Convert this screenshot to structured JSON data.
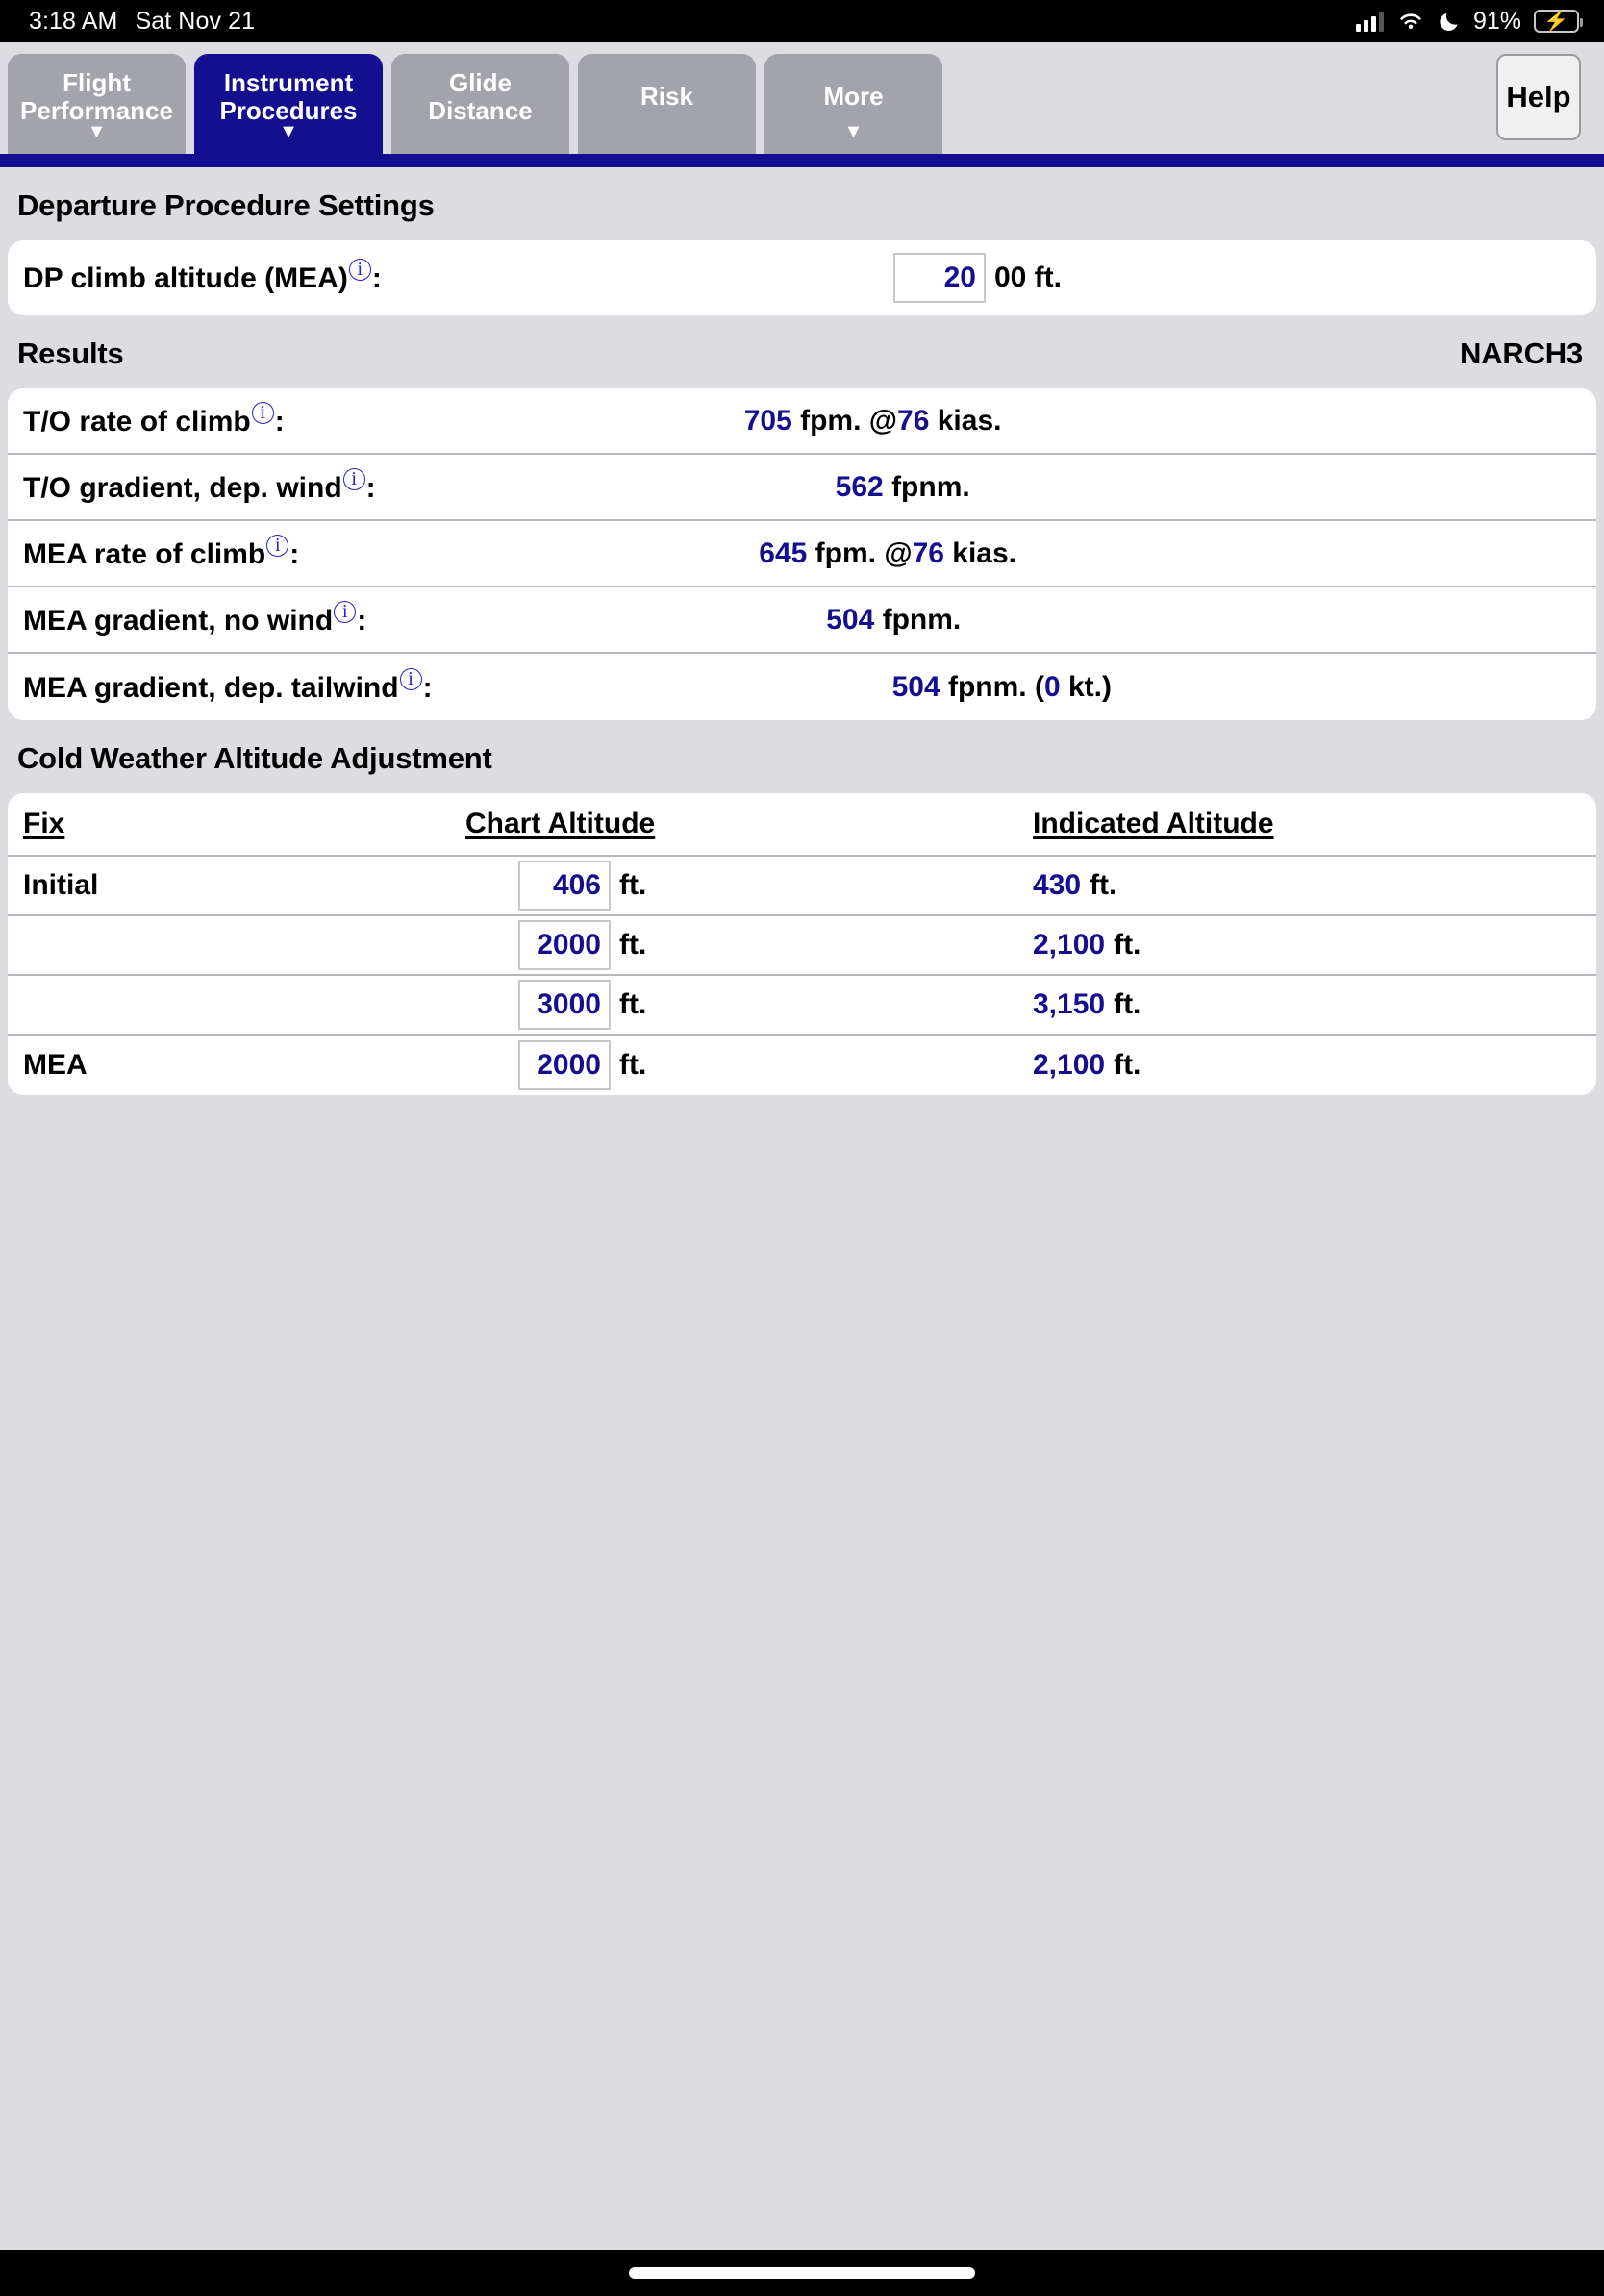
{
  "status_bar": {
    "time": "3:18 AM",
    "date": "Sat Nov 21",
    "battery_percent": "91%",
    "icons": [
      "cellular-signal-icon",
      "wifi-icon",
      "do-not-disturb-moon-icon",
      "battery-charging-icon"
    ]
  },
  "tabs": [
    {
      "line1": "Flight",
      "line2": "Performance",
      "caret": "▼",
      "active": false
    },
    {
      "line1": "Instrument",
      "line2": "Procedures",
      "caret": "▼",
      "active": true
    },
    {
      "line1": "Glide",
      "line2": "Distance",
      "caret": "",
      "active": false
    },
    {
      "line1": "Risk",
      "line2": "",
      "caret": "",
      "active": false
    },
    {
      "line1": "More",
      "line2": "",
      "caret": "▼",
      "active": false
    }
  ],
  "help_button": {
    "label": "Help"
  },
  "departure": {
    "title": "Departure Procedure Settings",
    "climb_altitude": {
      "label": "DP climb altitude (MEA)",
      "info": "ⓘ",
      "colon": ":",
      "value": "20",
      "suffix": "00 ft."
    }
  },
  "results": {
    "title": "Results",
    "procedure": "NARCH3",
    "rows": [
      {
        "label": "T/O rate of climb",
        "value": "705",
        "unit": " fpm. @",
        "value2": "76",
        "unit2": " kias."
      },
      {
        "label": "T/O gradient, dep. wind",
        "value": "562",
        "unit": " fpnm.",
        "value2": "",
        "unit2": ""
      },
      {
        "label": "MEA rate of climb",
        "value": "645",
        "unit": " fpm. @",
        "value2": "76",
        "unit2": " kias."
      },
      {
        "label": "MEA gradient, no wind",
        "value": "504",
        "unit": " fpnm.",
        "value2": "",
        "unit2": ""
      },
      {
        "label": "MEA gradient, dep. tailwind",
        "value": "504",
        "unit": " fpnm. (",
        "value2": "0",
        "unit2": " kt.)"
      }
    ]
  },
  "cold_weather": {
    "title": "Cold Weather Altitude Adjustment",
    "columns": [
      "Fix",
      "Chart Altitude",
      "Indicated Altitude"
    ],
    "unit": "ft.",
    "rows": [
      {
        "fix": "Initial",
        "chart_altitude": "406",
        "indicated_altitude": "430"
      },
      {
        "fix": "",
        "chart_altitude": "2000",
        "indicated_altitude": "2,100"
      },
      {
        "fix": "",
        "chart_altitude": "3000",
        "indicated_altitude": "3,150"
      },
      {
        "fix": "MEA",
        "chart_altitude": "2000",
        "indicated_altitude": "2,100"
      }
    ]
  },
  "colors": {
    "accent_navy": "#130f8f",
    "tab_inactive": "#a3a3ab",
    "page_background": "#dcdce1",
    "card_background": "#ffffff",
    "info_icon": "#2222cc"
  }
}
